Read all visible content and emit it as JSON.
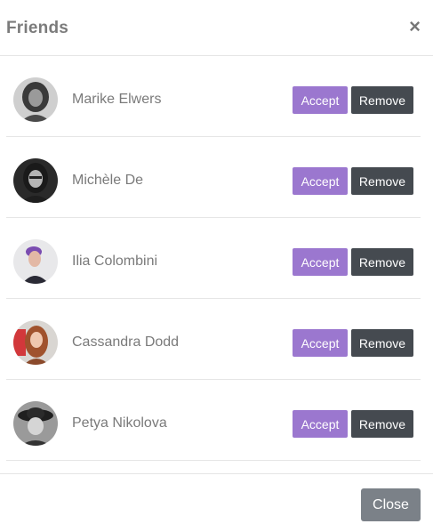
{
  "modal": {
    "title": "Friends",
    "close_icon": "×",
    "close_button_label": "Close"
  },
  "friends": [
    {
      "name": "Marike Elwers",
      "avatar": "woman-dark-curly-hair",
      "accept_label": "Accept",
      "remove_label": "Remove"
    },
    {
      "name": "Michèle De",
      "avatar": "woman-dark-hair-glasses",
      "accept_label": "Accept",
      "remove_label": "Remove"
    },
    {
      "name": "Ilia Colombini",
      "avatar": "woman-purple-hair",
      "accept_label": "Accept",
      "remove_label": "Remove"
    },
    {
      "name": "Cassandra Dodd",
      "avatar": "woman-red-hair",
      "accept_label": "Accept",
      "remove_label": "Remove"
    },
    {
      "name": "Petya Nikolova",
      "avatar": "woman-with-hat",
      "accept_label": "Accept",
      "remove_label": "Remove"
    }
  ],
  "colors": {
    "accept": "#9b77cf",
    "remove": "#454a50",
    "close": "#7b8188"
  }
}
